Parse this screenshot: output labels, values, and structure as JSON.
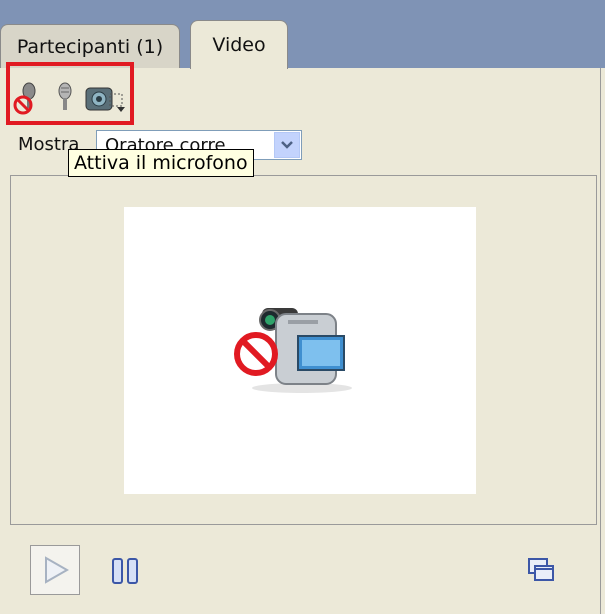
{
  "tabs": [
    {
      "label": "Partecipanti (1)",
      "active": false
    },
    {
      "label": "Video",
      "active": true
    }
  ],
  "toolbar": {
    "icons": [
      "microphone-disabled-icon",
      "microphone-icon",
      "speaker-settings-icon"
    ],
    "highlight_color": "#e11a22"
  },
  "mostra": {
    "label": "Mostra",
    "selected": "Oratore corre"
  },
  "tooltip": {
    "text": "Attiva il microfono"
  },
  "video": {
    "status_icon": "camera-disabled-icon"
  },
  "controls": {
    "icons": [
      "play-icon",
      "pause-icon",
      "popout-window-icon"
    ]
  },
  "colors": {
    "tab_bar": "#7f93b5",
    "panel": "#ece9d8",
    "tooltip_bg": "#ffffe1"
  }
}
